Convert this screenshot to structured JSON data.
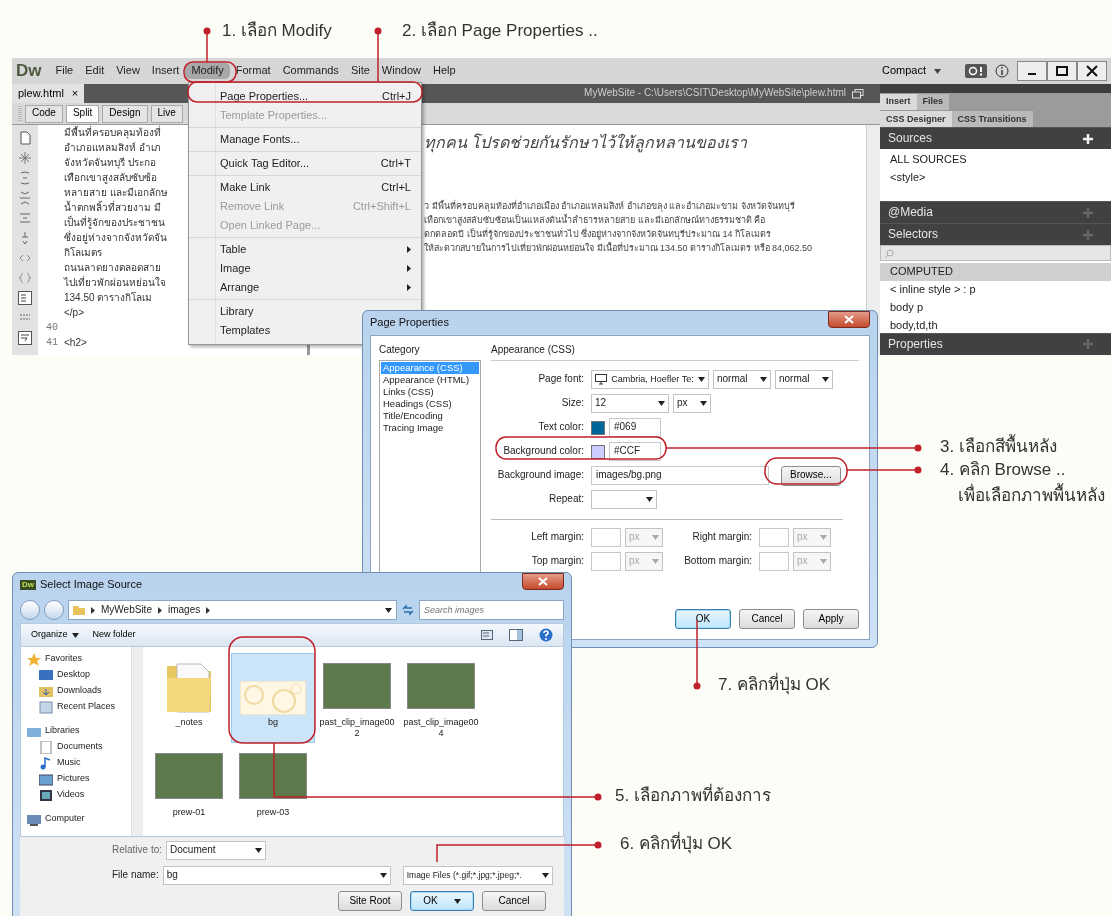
{
  "annotations": [
    {
      "text": "1. เลือก Modify"
    },
    {
      "text": "2. เลือก Page Properties .."
    },
    {
      "text": "3. เลือกสีพื้นหลัง"
    },
    {
      "text": "4. คลิก Browse .."
    },
    {
      "text": "เพื่อเลือกภาพพื้นหลัง"
    },
    {
      "text": "5. เลือกภาพที่ต้องการ"
    },
    {
      "text": "6. คลิกที่ปุ่ม OK"
    },
    {
      "text": "7. คลิกที่ปุ่ม OK"
    }
  ],
  "main_window": {
    "logo": "Dw",
    "menu": [
      {
        "label": "File",
        "selected": false
      },
      {
        "label": "Edit",
        "selected": false
      },
      {
        "label": "View",
        "selected": false
      },
      {
        "label": "Insert",
        "selected": false
      },
      {
        "label": "Modify",
        "selected": true
      },
      {
        "label": "Format",
        "selected": false
      },
      {
        "label": "Commands",
        "selected": false
      },
      {
        "label": "Site",
        "selected": false
      },
      {
        "label": "Window",
        "selected": false
      },
      {
        "label": "Help",
        "selected": false
      }
    ],
    "workspace": "Compact",
    "document_tab": {
      "label": "plew.html",
      "close": "×"
    },
    "document_path": "MyWebSite - C:\\Users\\CSIT\\Desktop\\MyWebSite\\plew.html",
    "view_buttons": [
      {
        "label": "Code",
        "selected": false
      },
      {
        "label": "Split",
        "selected": true
      },
      {
        "label": "Design",
        "selected": false
      },
      {
        "label": "Live",
        "selected": false
      }
    ],
    "code_lines": [
      {
        "text": "มีพื้นที่ครอบคลุมท้องที่"
      },
      {
        "text": "อำเภอแหลมสิงห์ อำเภ"
      },
      {
        "text": "จังหวัดจันทบุรี ประกอ"
      },
      {
        "text": "เทือกเขาสูงสลับซับซ้อ"
      },
      {
        "text": "หลายสาย และมีเอกลักษ"
      },
      {
        "text": "น้ำตกพลิ้วที่สวยงาม มี"
      },
      {
        "text": "เป็นที่รู้จักของประชาชน"
      },
      {
        "text": "ซึ่งอยู่ห่างจากจังหวัดจัน"
      },
      {
        "text": "กิโลเมตร"
      },
      {
        "text": "ถนนลาดยางตลอดสาย"
      },
      {
        "text": "ไปเที่ยวพักผ่อนหย่อนใจ"
      },
      {
        "text": "134.50 ตารางกิโลเม"
      },
      {
        "text": " </p>"
      },
      {
        "number": "40"
      },
      {
        "number": "41",
        "text": "<h2>"
      }
    ],
    "design_heading": "ทุกคน โปรดช่วยกันรักษาไว้ให้ลูกหลานของเรา",
    "design_lines": [
      "ว มีพื้นที่ครอบคลุมท้องที่อำเภอเมือง อำเภอแหลมสิงห์ อำเภอขลุง และอำเภอมะขาม จังหวัดจันทบุรี",
      "เทือกเขาสูงสลับซับซ้อนเป็นแหล่งต้นน้ำลำธารหลายสาย และมีเอกลักษณ์ทางธรรมชาติ คือ",
      "ตกตลอดปี เป็นที่รู้จักของประชาชนทั่วไป ซึ่งอยู่ห่างจากจังหวัดจันทบุรีประมาณ 14 กิโลเมตร",
      "ให้สะดวกสบายในการไปเที่ยวพักผ่อนหย่อนใจ มีเนื้อที่ประมาณ 134.50 ตารางกิโลเมตร หรือ 84,062.50"
    ],
    "panel": {
      "top_tabs": [
        {
          "label": "Insert",
          "selected": true
        },
        {
          "label": "Files",
          "selected": false
        }
      ],
      "designer_tabs": [
        {
          "label": "CSS Designer",
          "selected": true
        },
        {
          "label": "CSS Transitions",
          "selected": false
        }
      ],
      "sources": {
        "title": "Sources",
        "items": [
          "ALL SOURCES",
          "<style>"
        ]
      },
      "media": {
        "title": "@Media"
      },
      "selectors": {
        "title": "Selectors",
        "items": [
          {
            "label": "COMPUTED",
            "selected": true
          },
          {
            "label": "< inline style > : p",
            "selected": false
          },
          {
            "label": "body p",
            "selected": false
          },
          {
            "label": "body,td,th",
            "selected": false
          }
        ]
      },
      "properties": {
        "title": "Properties"
      }
    }
  },
  "modify_menu": {
    "groups": [
      {
        "items": [
          {
            "label": "Page Properties...",
            "shortcut": "Ctrl+J",
            "disabled": false,
            "submenu": false
          },
          {
            "label": "Template Properties...",
            "disabled": true,
            "submenu": false
          }
        ]
      },
      {
        "items": [
          {
            "label": "Manage Fonts...",
            "disabled": false,
            "submenu": false
          }
        ]
      },
      {
        "items": [
          {
            "label": "Quick Tag Editor...",
            "shortcut": "Ctrl+T",
            "disabled": false,
            "submenu": false
          }
        ]
      },
      {
        "items": [
          {
            "label": "Make Link",
            "shortcut": "Ctrl+L",
            "disabled": false,
            "submenu": false
          },
          {
            "label": "Remove Link",
            "shortcut": "Ctrl+Shift+L",
            "disabled": true,
            "submenu": false
          },
          {
            "label": "Open Linked Page...",
            "disabled": true,
            "submenu": false
          }
        ]
      },
      {
        "items": [
          {
            "label": "Table",
            "disabled": false,
            "submenu": true
          },
          {
            "label": "Image",
            "disabled": false,
            "submenu": true
          },
          {
            "label": "Arrange",
            "disabled": false,
            "submenu": true
          }
        ]
      },
      {
        "items": [
          {
            "label": "Library",
            "disabled": false
          },
          {
            "label": "Templates",
            "disabled": false
          }
        ]
      }
    ]
  },
  "page_properties": {
    "title": "Page Properties",
    "category_label": "Category",
    "categories": [
      {
        "label": "Appearance (CSS)",
        "selected": true
      },
      {
        "label": "Appearance (HTML)",
        "selected": false
      },
      {
        "label": "Links (CSS)",
        "selected": false
      },
      {
        "label": "Headings (CSS)",
        "selected": false
      },
      {
        "label": "Title/Encoding",
        "selected": false
      },
      {
        "label": "Tracing Image",
        "selected": false
      }
    ],
    "section_title": "Appearance (CSS)",
    "page_font": {
      "label": "Page font:",
      "family": "Cambria, Hoefler Te:",
      "weight": "normal",
      "style": "normal"
    },
    "size": {
      "label": "Size:",
      "value": "12",
      "unit": "px"
    },
    "text_color": {
      "label": "Text color:",
      "value": "#069",
      "color": "#006699"
    },
    "background_color": {
      "label": "Background color:",
      "value": "#CCF",
      "color": "#ccccff"
    },
    "background_image": {
      "label": "Background image:",
      "value": "images/bg.png",
      "button": "Browse..."
    },
    "repeat": {
      "label": "Repeat:"
    },
    "margins": [
      {
        "label": "Left margin:",
        "unit": "px",
        "disabled": true
      },
      {
        "label": "Right margin:",
        "unit": "px",
        "disabled": true
      },
      {
        "label": "Top margin:",
        "unit": "px",
        "disabled": true
      },
      {
        "label": "Bottom margin:",
        "unit": "px",
        "disabled": true
      }
    ],
    "buttons": [
      {
        "label": "OK",
        "default": true
      },
      {
        "label": "Cancel",
        "default": false
      },
      {
        "label": "Apply",
        "default": false
      }
    ]
  },
  "select_image_source": {
    "title": "Select Image Source",
    "icon_text": "Dw",
    "path": [
      "MyWebSite",
      "images"
    ],
    "search_placeholder": "Search images",
    "toolbar": [
      {
        "label": "Organize",
        "dropdown": true
      },
      {
        "label": "New folder",
        "dropdown": false
      }
    ],
    "nav": [
      {
        "label": "Favorites",
        "children": [
          {
            "label": "Desktop"
          },
          {
            "label": "Downloads"
          },
          {
            "label": "Recent Places"
          }
        ]
      },
      {
        "label": "Libraries",
        "children": [
          {
            "label": "Documents"
          },
          {
            "label": "Music"
          },
          {
            "label": "Pictures"
          },
          {
            "label": "Videos"
          }
        ]
      },
      {
        "label": "Computer"
      }
    ],
    "files": [
      {
        "name": "_notes",
        "kind": "folder",
        "selected": false
      },
      {
        "name": "bg",
        "kind": "pattern",
        "selected": true
      },
      {
        "name": "past_clip_image002",
        "kind": "photo",
        "selected": false
      },
      {
        "name": "past_clip_image004",
        "kind": "photo",
        "selected": false
      },
      {
        "name": "prew-01",
        "kind": "photo",
        "selected": false
      },
      {
        "name": "prew-03",
        "kind": "photo",
        "selected": false
      }
    ],
    "relative_to": {
      "label": "Relative to:",
      "value": "Document"
    },
    "file_name": {
      "label": "File name:",
      "value": "bg"
    },
    "filter": "Image Files (*.gif;*.jpg;*.jpeg;*.",
    "buttons": [
      {
        "label": "Site Root",
        "default": false,
        "split": false
      },
      {
        "label": "OK",
        "default": true,
        "split": true
      },
      {
        "label": "Cancel",
        "default": false,
        "split": false
      }
    ]
  }
}
